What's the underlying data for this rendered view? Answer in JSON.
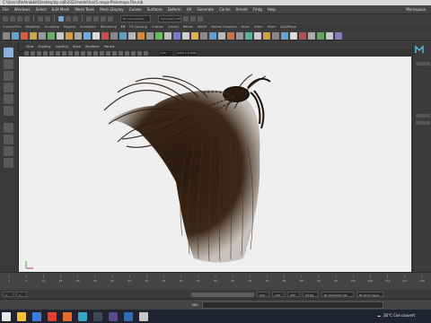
{
  "window": {
    "title": "C:\\Users\\ReAlrabbit\\Desktop\\tp sa8\\2022model\\hair5.maya-Pleinmaya File.mb"
  },
  "menubar": {
    "items": [
      "File",
      "Windows",
      "Select",
      "Edit Mesh",
      "Mesh Tools",
      "Mesh Display",
      "Curves",
      "Surfaces",
      "Deform",
      "UV",
      "Generate",
      "Cache",
      "Arnold",
      "Fmtg",
      "Help"
    ],
    "workspace": "Workspace"
  },
  "statusline": {
    "live_surface": "No Live Surface",
    "symmetry": "Symmetry: Off"
  },
  "shelf_tabs": {
    "items": [
      "Curves/Sfcs",
      "Modeling",
      "Sculpting",
      "Rigging",
      "Animation",
      "Rendering",
      "FX",
      "FX Caching",
      "Custom",
      "Arnold",
      "Bifrost",
      "MASH",
      "Motion Graphics",
      "XGen",
      "XGen",
      "XGen",
      "GoZ/Maya"
    ],
    "active_index": 6
  },
  "viewport": {
    "menu": [
      "View",
      "Shading",
      "Lighting",
      "Show",
      "Renderer",
      "Panels"
    ],
    "field_value": "0.00",
    "field_value2": "ACES 1.0 SDR-video (sRGB)"
  },
  "timeslider": {
    "ticks": [
      "1",
      "5",
      "10",
      "15",
      "20",
      "25",
      "30",
      "35",
      "40",
      "45",
      "50",
      "55",
      "60",
      "65",
      "70",
      "75",
      "80",
      "85",
      "90",
      "95",
      "100",
      "105",
      "110",
      "115",
      "120"
    ],
    "current_frame": "1"
  },
  "range": {
    "start": "1",
    "start2": "1",
    "end": "120",
    "end2": "120",
    "end3": "200",
    "fps": "24 fps",
    "character_set": "No Character Set",
    "anim_layer": "No Anim Layer"
  },
  "command_line": {
    "label": "MEL"
  },
  "taskbar": {
    "weather": "30°C  Ciel couvert",
    "icons": [
      "explorer-icon",
      "store-icon",
      "chrome-icon",
      "firefox-icon",
      "maya-icon",
      "app-icon",
      "app-icon",
      "app-icon",
      "app-icon",
      "app-icon"
    ]
  },
  "colors": {
    "accent": "#7ea2c8",
    "canvas": "#efefef",
    "taskbar": "#1f2430"
  }
}
